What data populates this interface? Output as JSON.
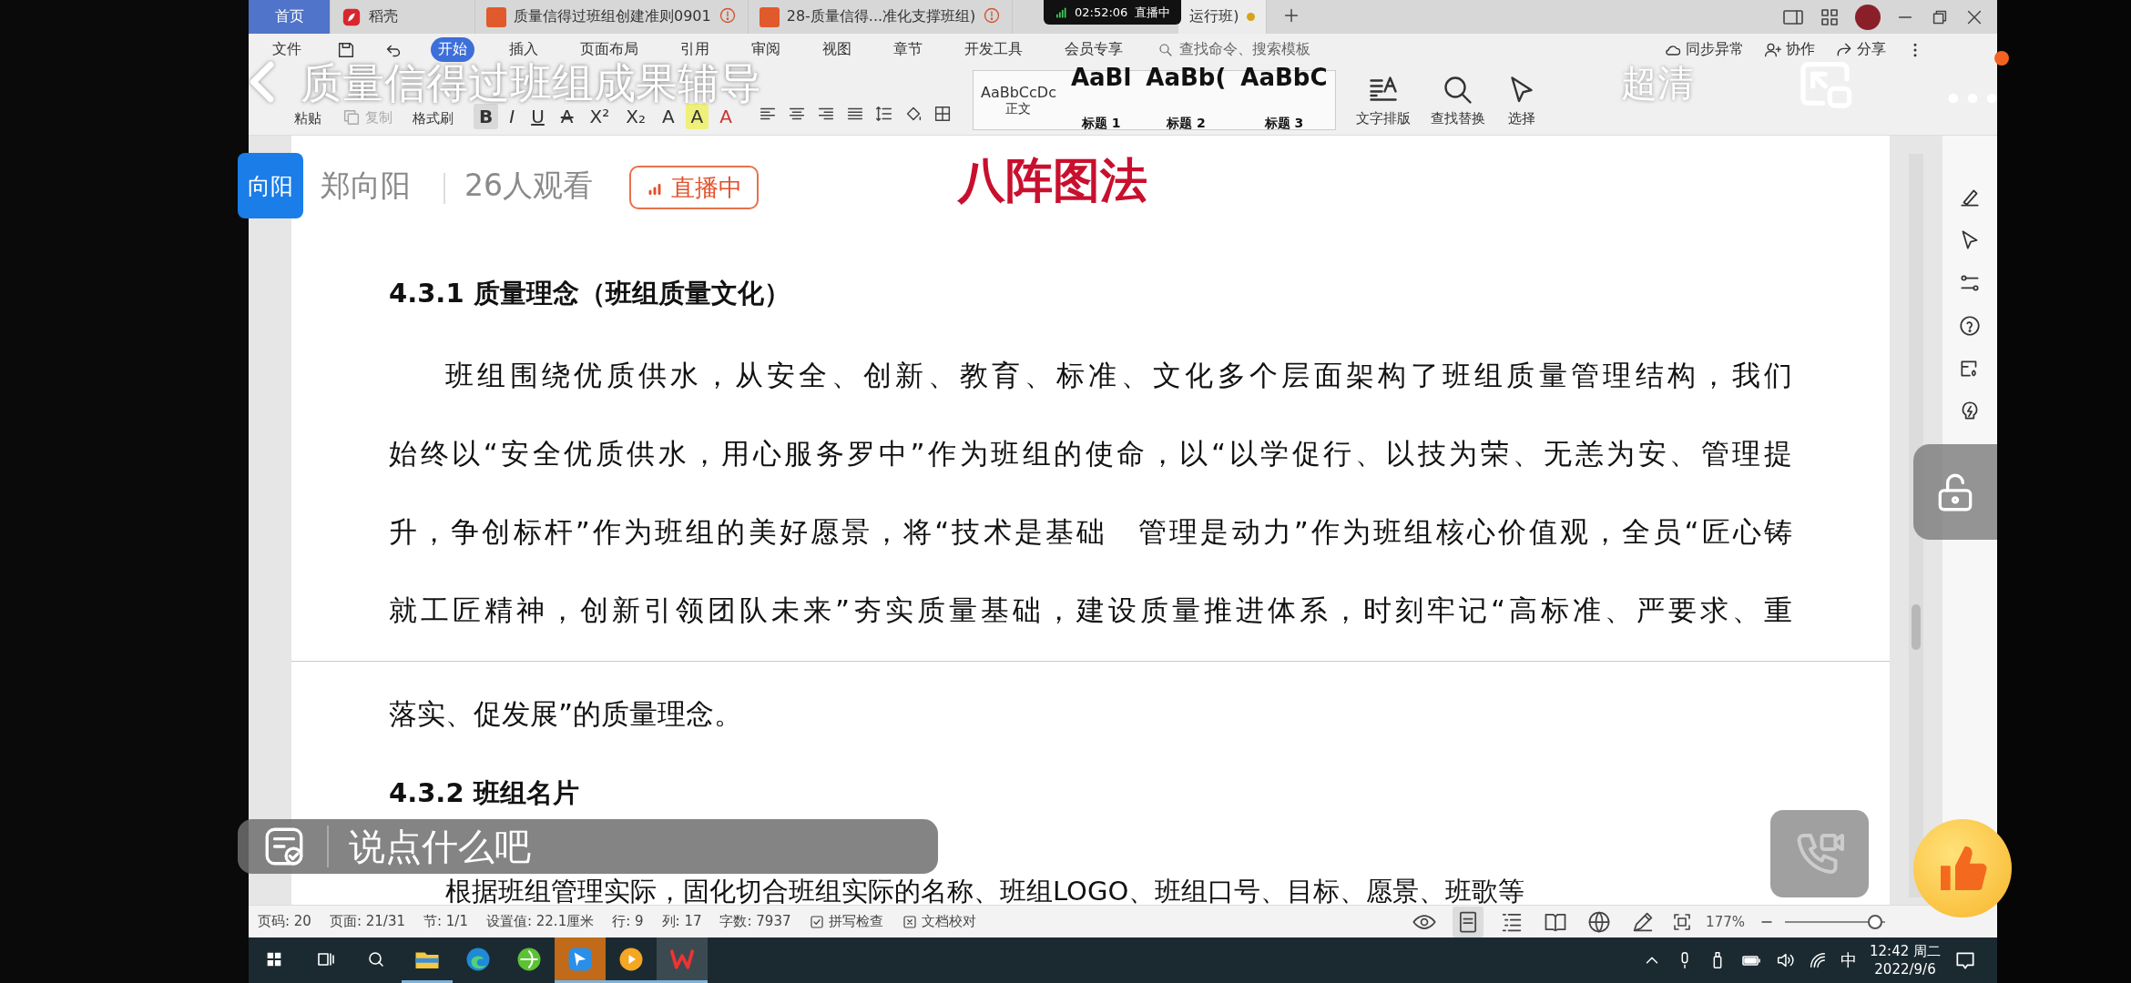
{
  "stream": {
    "title": "质量信得过班组成果辅导",
    "quality": "超清",
    "host_avatar": "向阳",
    "host_name": "郑向阳",
    "viewers": "26人观看",
    "live_badge": "直播中",
    "timer": "02:52:06",
    "timer_status": "直播中",
    "comment_placeholder": "说点什么吧"
  },
  "tabs": [
    {
      "label": "首页",
      "kind": "home",
      "selected": false,
      "unsaved": false
    },
    {
      "label": "稻壳",
      "kind": "app",
      "selected": false,
      "unsaved": false
    },
    {
      "label": "质量信得过班组创建准则0901",
      "kind": "doc",
      "selected": false,
      "unsaved": false
    },
    {
      "label": "28-质量信得...准化支撑班组)",
      "kind": "doc",
      "selected": false,
      "unsaved": false
    },
    {
      "label": "运行班)",
      "kind": "doc_partial",
      "selected": true,
      "unsaved": true
    }
  ],
  "menu": {
    "file": "文件",
    "ribbon_tabs": [
      {
        "label": "开始",
        "selected": true
      },
      {
        "label": "插入",
        "selected": false
      },
      {
        "label": "页面布局",
        "selected": false
      },
      {
        "label": "引用",
        "selected": false
      },
      {
        "label": "审阅",
        "selected": false
      },
      {
        "label": "视图",
        "selected": false
      },
      {
        "label": "章节",
        "selected": false
      },
      {
        "label": "开发工具",
        "selected": false
      },
      {
        "label": "会员专享",
        "selected": false
      }
    ],
    "search_placeholder": "查找命令、搜索模板",
    "actions": [
      "同步异常",
      "协作",
      "分享"
    ]
  },
  "toolbar": {
    "clipboard": [
      {
        "label": "粘贴",
        "kind": "paste",
        "disabled": false
      },
      {
        "label": "复制",
        "kind": "copy",
        "disabled": true
      },
      {
        "label": "格式刷",
        "kind": "brush",
        "disabled": false
      }
    ],
    "format": [
      {
        "glyph": "B",
        "selected": true
      },
      {
        "glyph": "I",
        "selected": false
      },
      {
        "glyph": "U",
        "selected": false
      },
      {
        "glyph": "A",
        "selected": false
      },
      {
        "glyph": "X²",
        "selected": false
      },
      {
        "glyph": "X₂",
        "selected": false
      },
      {
        "glyph": "A",
        "selected": false
      },
      {
        "glyph": "A",
        "selected": false
      },
      {
        "glyph": "A",
        "selected": false
      }
    ],
    "styles": [
      {
        "sample": "AaBbCcDc",
        "label": "正文"
      },
      {
        "sample": "AaBl",
        "label": "标题 1"
      },
      {
        "sample": "AaBb(",
        "label": "标题 2"
      },
      {
        "sample": "AaBbC",
        "label": "标题 3"
      }
    ],
    "big_tools": [
      {
        "label": "文字排版",
        "kind": "layout"
      },
      {
        "label": "查找替换",
        "kind": "find"
      },
      {
        "label": "选择",
        "kind": "select"
      }
    ]
  },
  "document": {
    "banner": "八阵图法",
    "heading_1": "4.3.1 质量理念（班组质量文化）",
    "paragraph_lines": [
      "班组围绕优质供水，从安全、创新、教育、标准、文化多个层面架构了班组质量管理结构，我们",
      "始终以“安全优质供水，用心服务罗中”作为班组的使命，以“以学促行、以技为荣、无恙为安、管理提",
      "升，争创标杆”作为班组的美好愿景，将“技术是基础　管理是动力”作为班组核心价值观，全员“匠心铸",
      "就工匠精神，创新引领团队未来”夯实质量基础，建设质量推进体系，时刻牢记“高标准、严要求、重"
    ],
    "continued_line": "落实、促发展”的质量理念。",
    "heading_2": "4.3.2 班组名片",
    "partial_line": "根据班组管理实际，固化切合班组实际的名称、班组LOGO、班组口号、目标、愿景、班歌等"
  },
  "status_bar": {
    "items": [
      "页码: 20",
      "页面: 21/31",
      "节: 1/1",
      "设置值: 22.1厘米",
      "行: 9",
      "列: 17",
      "字数: 7937"
    ],
    "checks": [
      "拼写检查",
      "文档校对"
    ],
    "view_modes": [
      {
        "kind": "read",
        "selected": false
      },
      {
        "kind": "page",
        "selected": true
      },
      {
        "kind": "outline",
        "selected": false
      },
      {
        "kind": "book",
        "selected": false
      },
      {
        "kind": "web",
        "selected": false
      },
      {
        "kind": "pen",
        "selected": false
      }
    ],
    "zoom": "177%",
    "zoom_level": {
      "level": 0.9
    }
  },
  "taskbar": {
    "apps": [
      {
        "kind": "explorer",
        "running": true,
        "attention": false,
        "selected": false
      },
      {
        "kind": "edge",
        "running": false,
        "attention": false,
        "selected": false
      },
      {
        "kind": "green",
        "running": false,
        "attention": false,
        "selected": false
      },
      {
        "kind": "blue",
        "running": true,
        "attention": true,
        "selected": false
      },
      {
        "kind": "orange",
        "running": true,
        "attention": false,
        "selected": false
      },
      {
        "kind": "wps",
        "running": true,
        "attention": false,
        "selected": true
      }
    ],
    "ime": "中",
    "time": "12:42 周二",
    "date": "2022/9/6"
  }
}
